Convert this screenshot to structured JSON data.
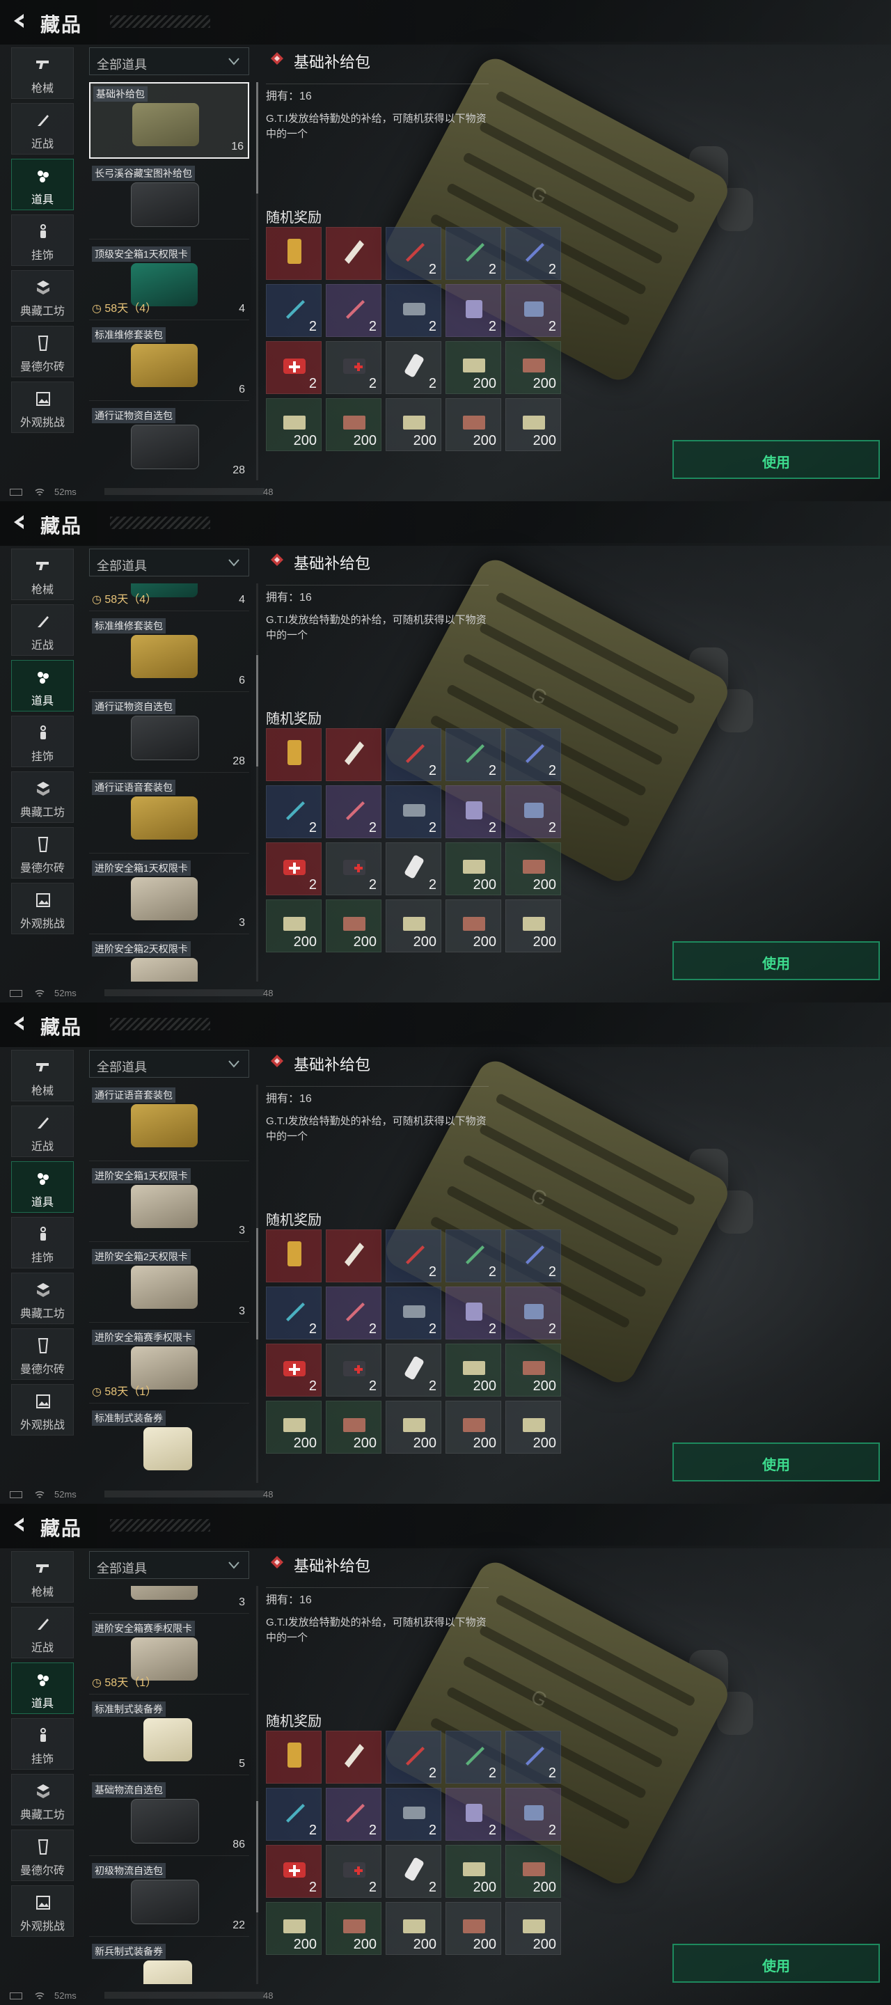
{
  "header": {
    "title": "藏品"
  },
  "sidebar": [
    {
      "label": "枪械",
      "icon": "gun-icon"
    },
    {
      "label": "近战",
      "icon": "knife-icon"
    },
    {
      "label": "道具",
      "icon": "items-icon",
      "active": true
    },
    {
      "label": "挂饰",
      "icon": "charm-icon"
    },
    {
      "label": "典藏工坊",
      "icon": "workshop-icon"
    },
    {
      "label": "曼德尔砖",
      "icon": "mandel-brick-icon"
    },
    {
      "label": "外观挑战",
      "icon": "image-challenge-icon"
    }
  ],
  "filter": {
    "value": "全部道具"
  },
  "detail": {
    "name": "基础补给包",
    "owned": "拥有：16",
    "description": "G.T.I发放给特勤处的补给，可随机获得以下物资中的一个",
    "reward_title": "随机奖励",
    "use_label": "使用"
  },
  "rewards": [
    {
      "count": "",
      "bg": "red"
    },
    {
      "count": "",
      "bg": "red"
    },
    {
      "count": "2",
      "bg": "blue"
    },
    {
      "count": "2",
      "bg": "blue"
    },
    {
      "count": "2",
      "bg": "blue"
    },
    {
      "count": "2",
      "bg": "blue"
    },
    {
      "count": "2",
      "bg": "purple"
    },
    {
      "count": "2",
      "bg": "blue"
    },
    {
      "count": "2",
      "bg": "purple"
    },
    {
      "count": "2",
      "bg": "purple"
    },
    {
      "count": "2",
      "bg": "red"
    },
    {
      "count": "2",
      "bg": "grey"
    },
    {
      "count": "2",
      "bg": "grey"
    },
    {
      "count": "200",
      "bg": "green"
    },
    {
      "count": "200",
      "bg": "green"
    },
    {
      "count": "200",
      "bg": "green"
    },
    {
      "count": "200",
      "bg": "green"
    },
    {
      "count": "200",
      "bg": "grey"
    },
    {
      "count": "200",
      "bg": "grey"
    },
    {
      "count": "200",
      "bg": "grey"
    }
  ],
  "status": {
    "ping": "52ms",
    "tail": "48"
  },
  "panels": [
    {
      "scroll": 0.0,
      "items": [
        {
          "name": "基础补给包",
          "count": "16",
          "thumb": "olive",
          "selected": true
        },
        {
          "name": "长弓溪谷藏宝图补给包",
          "count": "",
          "thumb": "dark"
        },
        {
          "name": "顶级安全箱1天权限卡",
          "count": "4",
          "thumb": "green",
          "timer": "58天（4）"
        },
        {
          "name": "标准维修套装包",
          "count": "6",
          "thumb": "yellow"
        },
        {
          "name": "通行证物资自选包",
          "count": "28",
          "thumb": "dark"
        }
      ]
    },
    {
      "scroll": 0.25,
      "items": [
        {
          "name": "",
          "count": "4",
          "thumb": "green",
          "timer": "58天（4）",
          "partial": true
        },
        {
          "name": "标准维修套装包",
          "count": "6",
          "thumb": "yellow"
        },
        {
          "name": "通行证物资自选包",
          "count": "28",
          "thumb": "dark"
        },
        {
          "name": "通行证语音套装包",
          "count": "",
          "thumb": "yellow"
        },
        {
          "name": "进阶安全箱1天权限卡",
          "count": "3",
          "thumb": "silver"
        },
        {
          "name": "进阶安全箱2天权限卡",
          "count": "",
          "thumb": "silver"
        }
      ]
    },
    {
      "scroll": 0.5,
      "items": [
        {
          "name": "通行证语音套装包",
          "count": "",
          "thumb": "yellow"
        },
        {
          "name": "进阶安全箱1天权限卡",
          "count": "3",
          "thumb": "silver"
        },
        {
          "name": "进阶安全箱2天权限卡",
          "count": "3",
          "thumb": "silver"
        },
        {
          "name": "进阶安全箱赛季权限卡",
          "count": "",
          "thumb": "silver",
          "timer": "58天（1）"
        },
        {
          "name": "标准制式装备券",
          "count": "",
          "thumb": "paper"
        }
      ]
    },
    {
      "scroll": 0.75,
      "items": [
        {
          "name": "",
          "count": "3",
          "thumb": "silver",
          "partial": true
        },
        {
          "name": "进阶安全箱赛季权限卡",
          "count": "",
          "thumb": "silver",
          "timer": "58天（1）"
        },
        {
          "name": "标准制式装备券",
          "count": "5",
          "thumb": "paper"
        },
        {
          "name": "基础物流自选包",
          "count": "86",
          "thumb": "dark"
        },
        {
          "name": "初级物流自选包",
          "count": "22",
          "thumb": "dark"
        },
        {
          "name": "新兵制式装备券",
          "count": "",
          "thumb": "paper"
        }
      ]
    }
  ]
}
